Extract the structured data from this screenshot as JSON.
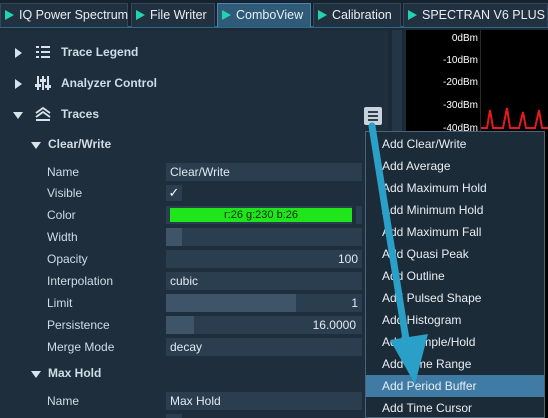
{
  "tabs": [
    {
      "label": "IQ Power Spectrum",
      "active": false
    },
    {
      "label": "File Writer",
      "active": false
    },
    {
      "label": "ComboView",
      "active": true
    },
    {
      "label": "Calibration",
      "active": false
    },
    {
      "label": "SPECTRAN V6 PLUS",
      "active": false
    }
  ],
  "sections": {
    "trace_legend": "Trace Legend",
    "analyzer_control": "Analyzer Control",
    "traces": "Traces"
  },
  "clear_write": {
    "header": "Clear/Write",
    "name_label": "Name",
    "name_value": "Clear/Write",
    "visible_label": "Visible",
    "visible_check": "✓",
    "color_label": "Color",
    "color_value": "r:26 g:230 b:26",
    "width_label": "Width",
    "width_value": "",
    "opacity_label": "Opacity",
    "opacity_value": "100",
    "interpolation_label": "Interpolation",
    "interpolation_value": "cubic",
    "limit_label": "Limit",
    "limit_value": "1",
    "persistence_label": "Persistence",
    "persistence_value": "16.0000",
    "merge_label": "Merge Mode",
    "merge_value": "decay"
  },
  "max_hold": {
    "header": "Max Hold",
    "name_label": "Name",
    "name_value": "Max Hold"
  },
  "plot": {
    "y_labels": [
      "0dBm",
      "-10dBm",
      "-20dBm",
      "-30dBm",
      "-40dBm"
    ]
  },
  "menu": {
    "items": [
      "Add Clear/Write",
      "Add Average",
      "Add Maximum Hold",
      "Add Minimum Hold",
      "Add Maximum Fall",
      "Add Quasi Peak",
      "Add Outline",
      "Add Pulsed Shape",
      "Add Histogram",
      "Add Sample/Hold",
      "Add Time Range",
      "Add Period Buffer",
      "Add Time Cursor"
    ],
    "highlighted": "Add Period Buffer"
  },
  "colors": {
    "accent": "#3f7ba5",
    "trace_color": "#1ae61a",
    "arrow": "#2a9fc7"
  }
}
